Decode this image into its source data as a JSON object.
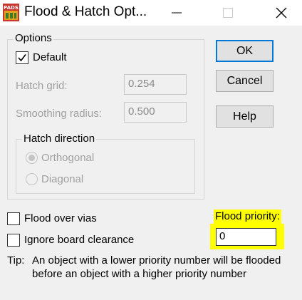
{
  "window": {
    "title": "Flood & Hatch Opt...",
    "app_icon_text": "PADS"
  },
  "options_group": {
    "title": "Options",
    "default_checkbox": {
      "label": "Default",
      "checked": true
    },
    "hatch_grid": {
      "label": "Hatch grid:",
      "value": "0.254"
    },
    "smoothing_radius": {
      "label": "Smoothing radius:",
      "value": "0.500"
    },
    "hatch_direction": {
      "title": "Hatch direction",
      "options": [
        {
          "label": "Orthogonal",
          "selected": true
        },
        {
          "label": "Diagonal",
          "selected": false
        }
      ]
    }
  },
  "buttons": {
    "ok": "OK",
    "cancel": "Cancel",
    "help": "Help"
  },
  "flood_over_vias": {
    "label": "Flood over vias",
    "checked": false
  },
  "ignore_board_clearance": {
    "label": "Ignore board clearance",
    "checked": false
  },
  "flood_priority": {
    "label": "Flood priority:",
    "value": "0"
  },
  "tip": {
    "label": "Tip:",
    "text": "An object with a lower priority number will be flooded before an object with a higher priority number"
  },
  "colors": {
    "highlight": "#ffff00",
    "accent": "#0078d7",
    "dialog_bg": "#f0f0f0"
  }
}
